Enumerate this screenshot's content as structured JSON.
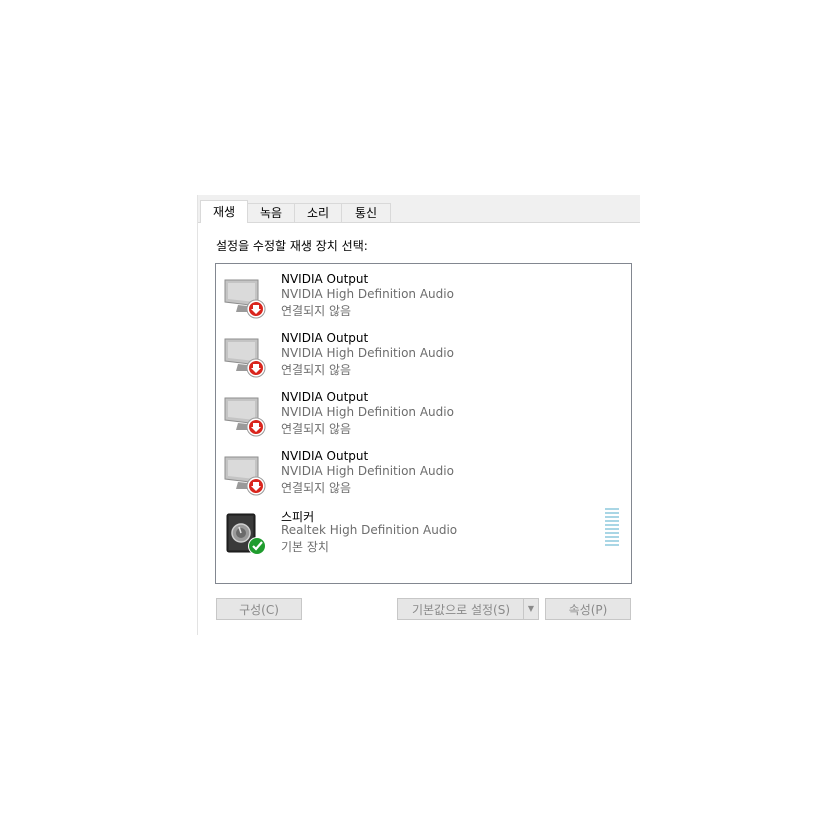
{
  "tabs": [
    {
      "label": "재생",
      "active": true
    },
    {
      "label": "녹음",
      "active": false
    },
    {
      "label": "소리",
      "active": false
    },
    {
      "label": "통신",
      "active": false
    }
  ],
  "instruction": "설정을 수정할 재생 장치 선택:",
  "devices": [
    {
      "name": "NVIDIA Output",
      "driver": "NVIDIA High Definition Audio",
      "status": "연결되지 않음",
      "icon": "monitor-disconnected-icon"
    },
    {
      "name": "NVIDIA Output",
      "driver": "NVIDIA High Definition Audio",
      "status": "연결되지 않음",
      "icon": "monitor-disconnected-icon"
    },
    {
      "name": "NVIDIA Output",
      "driver": "NVIDIA High Definition Audio",
      "status": "연결되지 않음",
      "icon": "monitor-disconnected-icon"
    },
    {
      "name": "NVIDIA Output",
      "driver": "NVIDIA High Definition Audio",
      "status": "연결되지 않음",
      "icon": "monitor-disconnected-icon"
    },
    {
      "name": "스피커",
      "driver": "Realtek High Definition Audio",
      "status": "기본 장치",
      "icon": "speaker-default-icon"
    }
  ],
  "buttons": {
    "configure": "구성(C)",
    "set_default": "기본값으로 설정(S)",
    "properties": "속성(P)"
  },
  "colors": {
    "disconnected_badge": "#d9251d",
    "default_badge": "#1f9c2e",
    "meter": "#a9d6e5"
  }
}
